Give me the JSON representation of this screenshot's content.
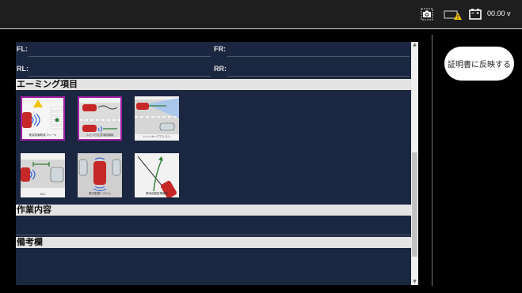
{
  "header": {
    "voltage": "00.00 v",
    "icons": [
      "camera-icon",
      "battery-warning-icon",
      "battery-icon"
    ]
  },
  "sidebar": {
    "apply_button": "証明書に反映する"
  },
  "tires": {
    "fl_label": "FL:",
    "fr_label": "FR:",
    "rl_label": "RL:",
    "rr_label": "RR:",
    "fl_value": "",
    "fr_value": "",
    "rl_value": "",
    "rr_value": ""
  },
  "sections": {
    "aiming_title": "エーミング項目",
    "work_title": "作業内容",
    "notes_title": "備考欄"
  },
  "aiming_items": [
    {
      "caption": "衝突被害軽減ブレーキ",
      "selected": true
    },
    {
      "caption": "ふらつき注意喚起機能",
      "selected": true
    },
    {
      "caption": "レーンキープアシスト",
      "selected": false
    },
    {
      "caption": "ACC",
      "selected": false
    },
    {
      "caption": "周辺監視システム",
      "selected": false
    },
    {
      "caption": "車両自動駐車機能",
      "selected": false
    }
  ],
  "colors": {
    "panel_bg": "#1b2640",
    "selected_border": "#a21fa6",
    "section_bg": "#e3e3e3"
  }
}
